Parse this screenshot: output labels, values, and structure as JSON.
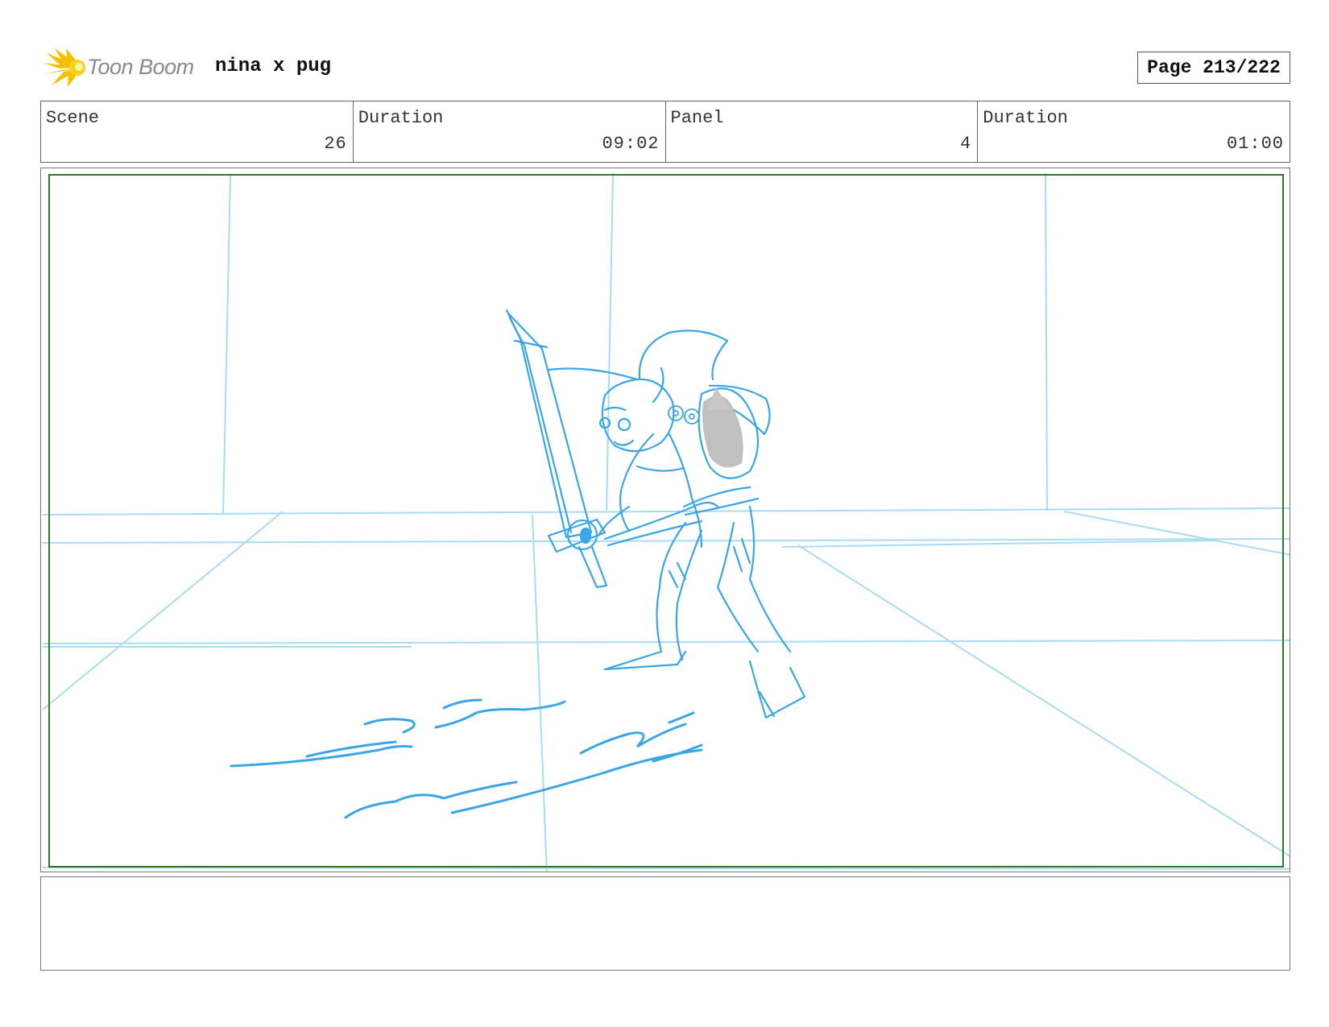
{
  "header": {
    "logo_text": "Toon Boom",
    "project_title": "nina x pug",
    "page_label": "Page 213/222"
  },
  "info": {
    "scene_label": "Scene",
    "scene_value": "26",
    "scene_duration_label": "Duration",
    "scene_duration_value": "09:02",
    "panel_label": "Panel",
    "panel_value": "4",
    "panel_duration_label": "Duration",
    "panel_duration_value": "01:00"
  },
  "notes": {
    "text": ""
  },
  "colors": {
    "sketch_blue": "#3aa6e8",
    "perspective_light_blue": "#a9dcf4",
    "safe_frame_green": "#2d7a2d",
    "logo_yellow": "#f5c000",
    "logo_gray": "#8a8a8a",
    "shading_gray": "#b5b5b5"
  },
  "icons": {
    "logo": "toon-boom-sunburst-icon"
  }
}
